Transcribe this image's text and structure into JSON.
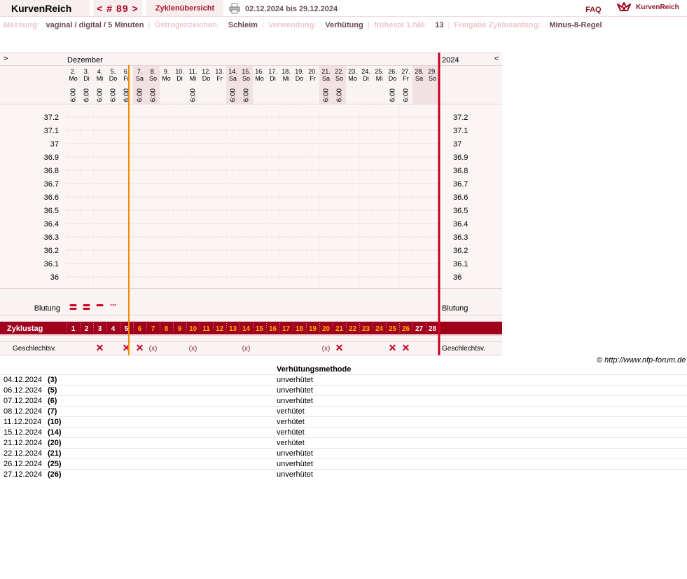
{
  "header": {
    "brand": "KurvenReich",
    "cycle": "< # 89 >",
    "overview": "Zyklenübersicht",
    "date_range": "02.12.2024 bis 29.12.2024",
    "faq": "FAQ",
    "logo_text": "KurvenReich"
  },
  "meta": {
    "measurement_label": "Messung:",
    "measurement_value": "vaginal / digital / 5 Minuten",
    "estrogen_label": "Östrogenzeichen:",
    "estrogen_value": "Schleim",
    "usage_label": "Verwendung:",
    "usage_value": "Verhütung",
    "earliest_label": "früheste 1.hM:",
    "earliest_value": "13",
    "release_label": "Freigabe Zyklusanfang:",
    "release_value": "Minus-8-Regel"
  },
  "chart": {
    "nav_left": ">",
    "nav_right": "<",
    "month": "Dezember",
    "year": "2024",
    "days": [
      {
        "d": "2.",
        "w": "Mo",
        "t": "6:00",
        "we": false
      },
      {
        "d": "3.",
        "w": "Di",
        "t": "6:00",
        "we": false
      },
      {
        "d": "4.",
        "w": "Mi",
        "t": "6:00",
        "we": false
      },
      {
        "d": "5.",
        "w": "Do",
        "t": "6:00",
        "we": false
      },
      {
        "d": "6.",
        "w": "Fr",
        "t": "6:00",
        "we": false
      },
      {
        "d": "7.",
        "w": "Sa",
        "t": "6:00",
        "we": true
      },
      {
        "d": "8.",
        "w": "So",
        "t": "6:00",
        "we": true
      },
      {
        "d": "9.",
        "w": "Mo",
        "t": "",
        "we": false
      },
      {
        "d": "10.",
        "w": "Di",
        "t": "",
        "we": false
      },
      {
        "d": "11.",
        "w": "Mi",
        "t": "6:00",
        "we": false
      },
      {
        "d": "12.",
        "w": "Do",
        "t": "",
        "we": false
      },
      {
        "d": "13.",
        "w": "Fr",
        "t": "",
        "we": false
      },
      {
        "d": "14.",
        "w": "Sa",
        "t": "6:00",
        "we": true
      },
      {
        "d": "15.",
        "w": "So",
        "t": "6:00",
        "we": true
      },
      {
        "d": "16.",
        "w": "Mo",
        "t": "",
        "we": false
      },
      {
        "d": "17.",
        "w": "Di",
        "t": "",
        "we": false
      },
      {
        "d": "18.",
        "w": "Mi",
        "t": "",
        "we": false
      },
      {
        "d": "19.",
        "w": "Do",
        "t": "",
        "we": false
      },
      {
        "d": "20.",
        "w": "Fr",
        "t": "",
        "we": false
      },
      {
        "d": "21.",
        "w": "Sa",
        "t": "6:00",
        "we": true
      },
      {
        "d": "22.",
        "w": "So",
        "t": "6:00",
        "we": true
      },
      {
        "d": "23.",
        "w": "Mo",
        "t": "",
        "we": false
      },
      {
        "d": "24.",
        "w": "Di",
        "t": "",
        "we": false
      },
      {
        "d": "25.",
        "w": "Mi",
        "t": "",
        "we": false
      },
      {
        "d": "26.",
        "w": "Do",
        "t": "6:00",
        "we": false
      },
      {
        "d": "27.",
        "w": "Fr",
        "t": "6:00",
        "we": false
      },
      {
        "d": "28.",
        "w": "Sa",
        "t": "",
        "we": true
      },
      {
        "d": "29.",
        "w": "So",
        "t": "",
        "we": true
      }
    ],
    "temps": [
      "37.2",
      "37.1",
      "37",
      "36.9",
      "36.8",
      "36.7",
      "36.6",
      "36.5",
      "36.4",
      "36.3",
      "36.2",
      "36.1",
      "36"
    ],
    "bleeding_label": "Blutung",
    "bleeding_levels": [
      3,
      3,
      2,
      1,
      0,
      0,
      0,
      0,
      0,
      0,
      0,
      0,
      0,
      0,
      0,
      0,
      0,
      0,
      0,
      0,
      0,
      0,
      0,
      0,
      0,
      0,
      0,
      0
    ],
    "cycleday_label": "Zyklustag",
    "cycle_days": [
      "1",
      "2",
      "3",
      "4",
      "5",
      "6",
      "7",
      "8",
      "9",
      "10",
      "11",
      "12",
      "13",
      "14",
      "15",
      "16",
      "17",
      "18",
      "19",
      "20",
      "21",
      "22",
      "23",
      "24",
      "25",
      "26",
      "27",
      "28"
    ],
    "cycle_day_colors": [
      "w",
      "w",
      "w",
      "w",
      "w",
      "o",
      "o",
      "o",
      "o",
      "o",
      "o",
      "o",
      "o",
      "o",
      "o",
      "o",
      "o",
      "o",
      "o",
      "o",
      "o",
      "o",
      "o",
      "o",
      "o",
      "o",
      "w",
      "w"
    ],
    "intercourse_label": "Geschlechtsv.",
    "intercourse": [
      "",
      "",
      "x",
      "",
      "x",
      "x",
      "(x)",
      "",
      "",
      "(x)",
      "",
      "",
      "",
      "(x)",
      "",
      "",
      "",
      "",
      "",
      "(x)",
      "x",
      "",
      "",
      "",
      "x",
      "x",
      "",
      ""
    ],
    "colors": {
      "accent": "#a0001b",
      "orange": "#f08c00",
      "weekend": "#f2e1e3"
    }
  },
  "footer": {
    "copyright": "© http://www.nfp-forum.de",
    "method_header": "Verhütungsmethode",
    "rows": [
      {
        "date": "04.12.2024",
        "day": "(3)",
        "method": "unverhütet"
      },
      {
        "date": "06.12.2024",
        "day": "(5)",
        "method": "unverhütet"
      },
      {
        "date": "07.12.2024",
        "day": "(6)",
        "method": "unverhütet"
      },
      {
        "date": "08.12.2024",
        "day": "(7)",
        "method": "verhütet"
      },
      {
        "date": "11.12.2024",
        "day": "(10)",
        "method": "verhütet"
      },
      {
        "date": "15.12.2024",
        "day": "(14)",
        "method": "verhütet"
      },
      {
        "date": "21.12.2024",
        "day": "(20)",
        "method": "verhütet"
      },
      {
        "date": "22.12.2024",
        "day": "(21)",
        "method": "unverhütet"
      },
      {
        "date": "26.12.2024",
        "day": "(25)",
        "method": "unverhütet"
      },
      {
        "date": "27.12.2024",
        "day": "(26)",
        "method": "unverhütet"
      }
    ]
  }
}
